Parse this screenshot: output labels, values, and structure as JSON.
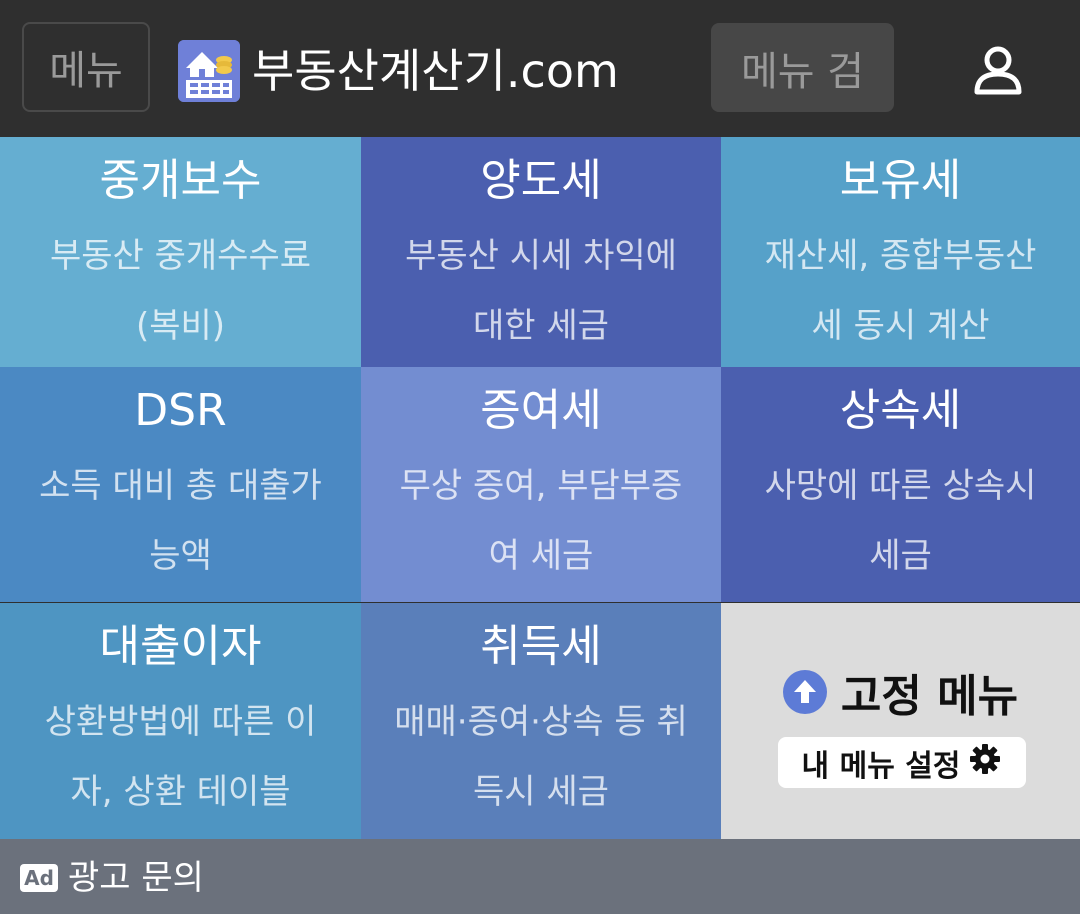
{
  "header": {
    "menu_label": "메뉴",
    "site_name": "부동산계산기.com",
    "search_label": "메뉴 검",
    "user_icon": "user-icon",
    "logo_icon": "house-calculator-logo"
  },
  "tiles": [
    {
      "title": "중개보수",
      "desc": "부동산 중개수수료(복비)",
      "color": "#65aed1"
    },
    {
      "title": "양도세",
      "desc": "부동산 시세 차익에 대한 세금",
      "color": "#4b5faf"
    },
    {
      "title": "보유세",
      "desc": "재산세, 종합부동산세 동시 계산",
      "color": "#56a1c9"
    },
    {
      "title": "DSR",
      "desc": "소득 대비 총 대출가능액",
      "color": "#4b89c3"
    },
    {
      "title": "증여세",
      "desc": "무상 증여, 부담부증여 세금",
      "color": "#738dd1"
    },
    {
      "title": "상속세",
      "desc": "사망에 따른 상속시 세금",
      "color": "#4b5faf"
    },
    {
      "title": "대출이자",
      "desc": "상환방법에 따른 이자, 상환 테이블",
      "color": "#4e95c2"
    },
    {
      "title": "취득세",
      "desc": "매매·증여·상속 등 취득시 세금",
      "color": "#5a7fba"
    }
  ],
  "fixed_menu": {
    "title": "고정 메뉴",
    "settings_label": "내 메뉴 설정",
    "up_icon": "arrow-up-circle-icon",
    "gear_icon": "gear-icon"
  },
  "footer": {
    "ad_badge": "Ad",
    "ad_text": "광고 문의"
  }
}
